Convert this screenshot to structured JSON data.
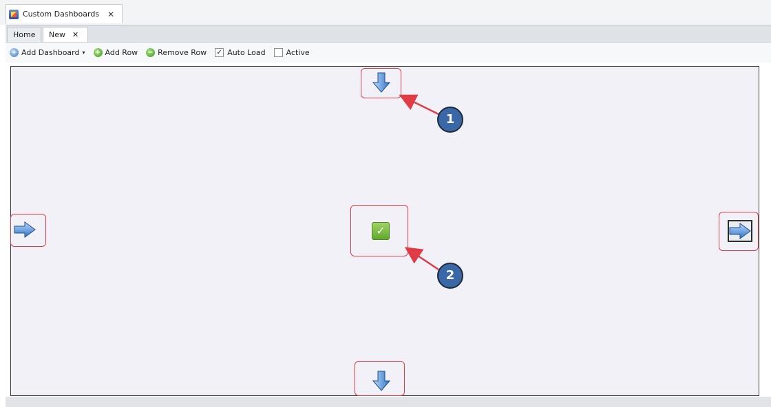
{
  "window": {
    "tab_title": "Custom Dashboards",
    "tab_close_glyph": "✕",
    "app_icon": "dashboard-icon"
  },
  "subtabs": {
    "home_label": "Home",
    "new_label": "New",
    "new_close_glyph": "✕"
  },
  "toolbar": {
    "add_dashboard_label": "Add Dashboard",
    "add_dashboard_caret": "▾",
    "add_row_label": "Add Row",
    "remove_row_label": "Remove Row",
    "auto_load_label": "Auto Load",
    "auto_load_checked": true,
    "active_label": "Active",
    "active_checked": false,
    "add_dashboard_glyph": "+",
    "add_row_glyph": "+",
    "remove_row_glyph": "−",
    "auto_load_glyph": "✓"
  },
  "canvas": {
    "center_icon_glyph": "✓",
    "top_arrow_icon": "arrow-down-icon",
    "bottom_arrow_icon": "arrow-down-icon",
    "left_arrow_icon": "arrow-right-icon",
    "right_arrow_icon": "arrow-right-boxed-icon"
  },
  "callouts": {
    "one": "1",
    "two": "2"
  },
  "colors": {
    "highlight_frame": "#e03c46",
    "callout_fill": "#3a67a5",
    "arrow_blue": "#3f86d8"
  }
}
